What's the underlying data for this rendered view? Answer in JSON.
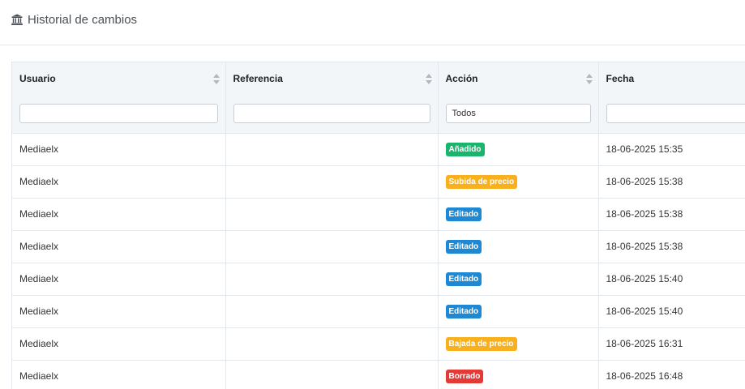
{
  "header": {
    "title": "Historial de cambios",
    "icon": "bank-icon"
  },
  "table": {
    "columns": [
      {
        "key": "user",
        "label": "Usuario"
      },
      {
        "key": "reference",
        "label": "Referencia"
      },
      {
        "key": "action",
        "label": "Acción"
      },
      {
        "key": "date",
        "label": "Fecha"
      }
    ],
    "filters": {
      "user": "",
      "reference": "",
      "action": "Todos",
      "date": ""
    },
    "badge_colors": {
      "added": "#1bb46c",
      "price_up": "#f8b11c",
      "edited": "#1f88d3",
      "price_down": "#f8b11c",
      "deleted": "#e53935"
    },
    "rows": [
      {
        "user": "Mediaelx",
        "reference": "",
        "action": "Añadido",
        "action_type": "added",
        "date": "18-06-2025 15:35"
      },
      {
        "user": "Mediaelx",
        "reference": "",
        "action": "Subida de precio",
        "action_type": "price_up",
        "date": "18-06-2025 15:38"
      },
      {
        "user": "Mediaelx",
        "reference": "",
        "action": "Editado",
        "action_type": "edited",
        "date": "18-06-2025 15:38"
      },
      {
        "user": "Mediaelx",
        "reference": "",
        "action": "Editado",
        "action_type": "edited",
        "date": "18-06-2025 15:38"
      },
      {
        "user": "Mediaelx",
        "reference": "",
        "action": "Editado",
        "action_type": "edited",
        "date": "18-06-2025 15:40"
      },
      {
        "user": "Mediaelx",
        "reference": "",
        "action": "Editado",
        "action_type": "edited",
        "date": "18-06-2025 15:40"
      },
      {
        "user": "Mediaelx",
        "reference": "",
        "action": "Bajada de precio",
        "action_type": "price_down",
        "date": "18-06-2025 16:31"
      },
      {
        "user": "Mediaelx",
        "reference": "",
        "action": "Borrado",
        "action_type": "deleted",
        "date": "18-06-2025 16:48"
      }
    ]
  }
}
